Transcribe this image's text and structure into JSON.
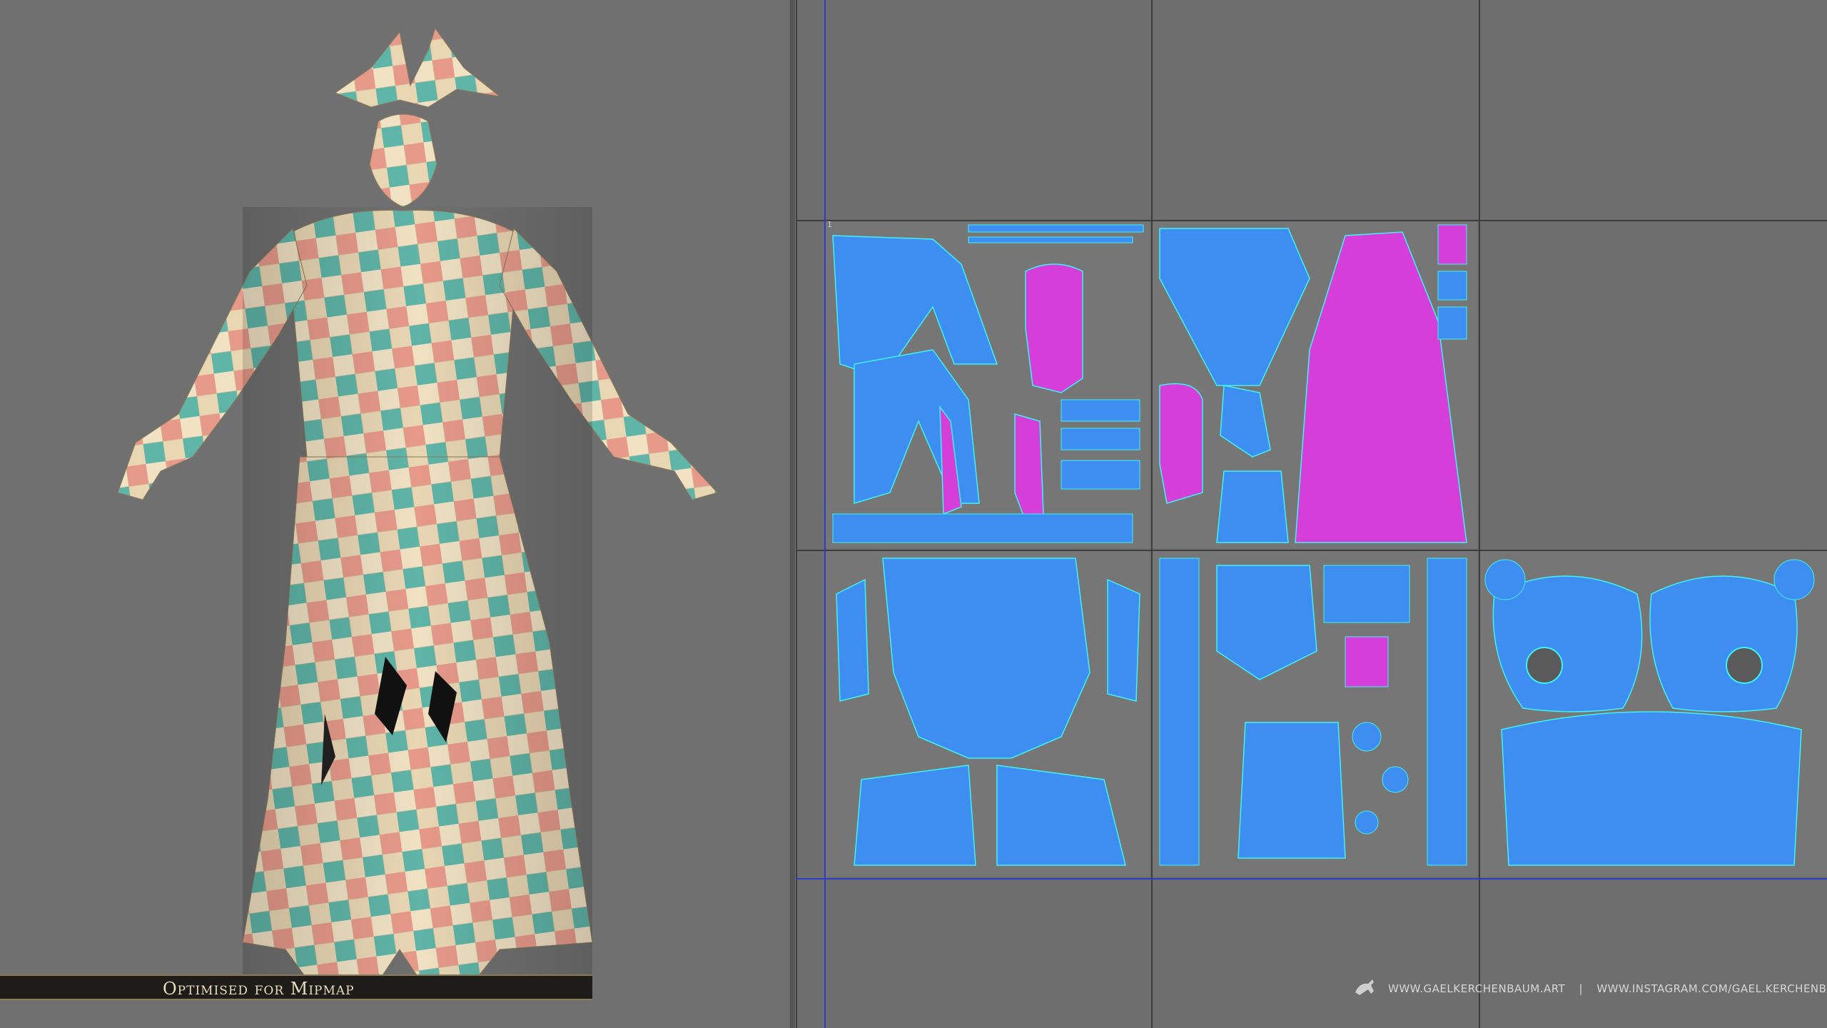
{
  "viewport": {
    "background_color": "#707070",
    "checker_colors": [
      "#f1e2c4",
      "#e89a8a",
      "#5fb5a8",
      "#e9d7b4"
    ],
    "banner": {
      "text": "Optimised for Mipmap"
    }
  },
  "uv_editor": {
    "background_color": "#6e6e6e",
    "shell_colors": {
      "blue": "#3d8ef0",
      "magenta": "#d63ed9",
      "cyan_edges": "#3ff2f5"
    },
    "tiles": [
      {
        "id": "tile-1001",
        "label": "1",
        "content": "cloth and armor shells"
      },
      {
        "id": "tile-1002",
        "label": "",
        "content": "hood, skirt and small shells"
      },
      {
        "id": "tile-1011",
        "label": "",
        "content": "torso armor shells"
      },
      {
        "id": "tile-1012",
        "label": "",
        "content": "gear and belt shells"
      },
      {
        "id": "tile-1013",
        "label": "",
        "content": "head shells"
      }
    ]
  },
  "credits": {
    "website": "WWW.GAELKERCHENBAUM.ART",
    "separator": "|",
    "instagram": "WWW.INSTAGRAM.COM/GAEL.KERCHENBAUM"
  }
}
